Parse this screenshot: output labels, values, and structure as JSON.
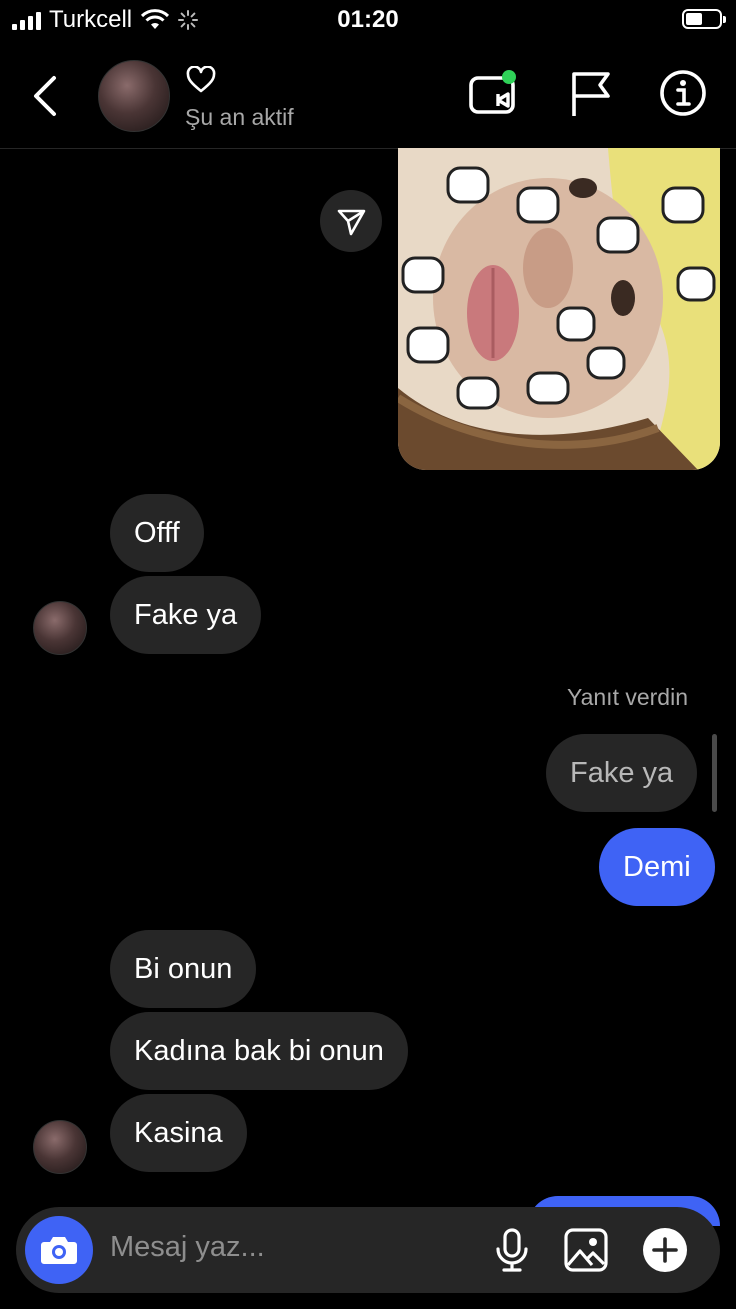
{
  "status_bar": {
    "carrier": "Turkcell",
    "time": "01:20"
  },
  "header": {
    "status": "Şu an aktif",
    "icons": [
      "back-chevron-icon",
      "heart-icon",
      "video-call-icon",
      "flag-icon",
      "info-icon"
    ],
    "online_dot_color": "#2fd158"
  },
  "messages": {
    "incoming_1": [
      "Offf",
      "Fake ya"
    ],
    "replied_label": "Yanıt verdin",
    "quoted_text": "Fake ya",
    "outgoing_1": "Demi",
    "incoming_2": [
      "Bi onun",
      "Kadına bak bi onun",
      "Kasina"
    ]
  },
  "composer": {
    "placeholder": "Mesaj yaz...",
    "icons": [
      "camera-icon",
      "microphone-icon",
      "gallery-icon",
      "plus-icon"
    ]
  },
  "colors": {
    "background": "#000000",
    "incoming_bubble": "#262626",
    "outgoing_bubble": "#3f63f5",
    "secondary_text": "#a8a8a8"
  }
}
